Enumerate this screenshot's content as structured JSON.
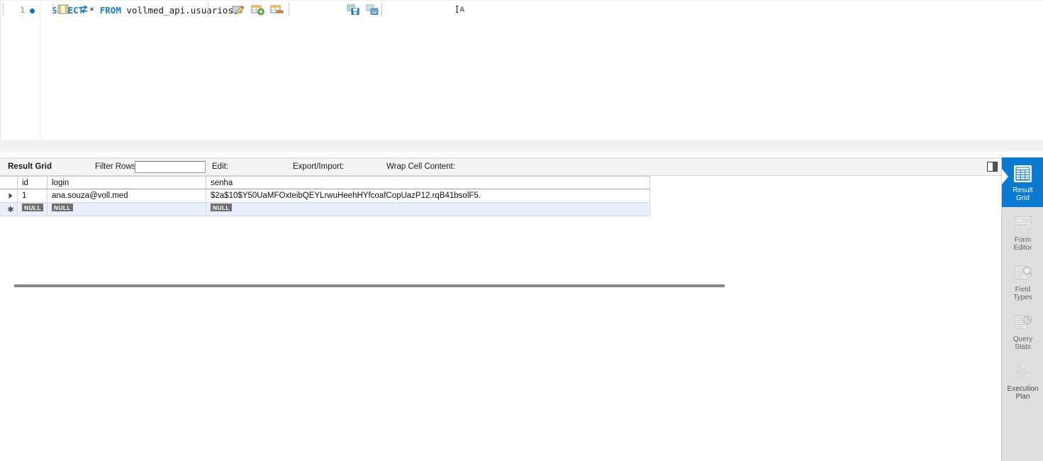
{
  "editor": {
    "line_number": "1",
    "code": {
      "kw_select": "SELECT",
      "star": "*",
      "kw_from": "FROM",
      "table": "vollmed_api.usuarios;",
      "full_text": "SELECT * FROM vollmed_api.usuarios;"
    }
  },
  "toolbar": {
    "result_grid_label": "Result Grid",
    "grid_icon": "grid-columns-icon",
    "refresh_icon": "refresh-icon",
    "filter_label": "Filter Rows:",
    "filter_value": "",
    "filter_placeholder": "",
    "edit_label": "Edit:",
    "edit_pencil_icon": "edit-pencil-icon",
    "edit_insert_icon": "insert-row-icon",
    "edit_delete_icon": "delete-row-icon",
    "export_import_label": "Export/Import:",
    "export_icon": "export-save-icon",
    "import_icon": "import-open-icon",
    "wrap_label": "Wrap Cell Content:",
    "wrap_icon": "wrap-text-icon",
    "split_toggle_icon": "split-panel-icon"
  },
  "grid": {
    "columns": [
      "id",
      "login",
      "senha"
    ],
    "rows": [
      {
        "marker": "current-row-arrow",
        "id": "1",
        "login": "ana.souza@voll.med",
        "senha": "$2a$10$Y50UaMFOxteibQEYLrwuHeehHYfcoafCopUazP12.rqB41bsolF5."
      }
    ],
    "new_row": {
      "marker": "new-row-asterisk",
      "id": "NULL",
      "login": "NULL",
      "senha": "NULL"
    },
    "null_badge_text": "NULL"
  },
  "sidebar": {
    "items": [
      {
        "label": "Result\nGrid",
        "icon": "result-grid-icon",
        "active": true
      },
      {
        "label": "Form\nEditor",
        "icon": "form-editor-icon",
        "active": false
      },
      {
        "label": "Field\nTypes",
        "icon": "field-types-icon",
        "active": false
      },
      {
        "label": "Query\nStats",
        "icon": "query-stats-icon",
        "active": false
      },
      {
        "label": "Execution\nPlan",
        "icon": "execution-plan-icon",
        "active": false
      }
    ]
  },
  "colors": {
    "accent_blue": "#0a7ad0",
    "keyword_blue": "#1b7bbd",
    "sidebar_bg": "#dededf",
    "toolbar_bg": "#f4f4f5",
    "selected_row": "#e8eefb",
    "null_badge": "#6f6f6f"
  }
}
